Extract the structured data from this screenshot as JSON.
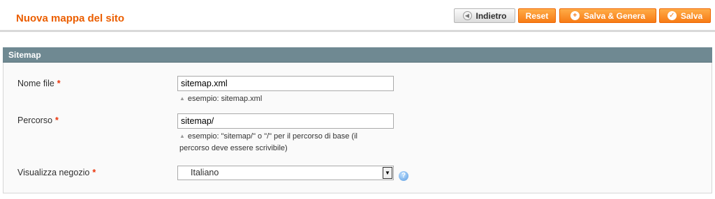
{
  "header": {
    "title": "Nuova mappa del sito",
    "buttons": {
      "back": "Indietro",
      "reset": "Reset",
      "save_generate": "Salva & Genera",
      "save": "Salva"
    }
  },
  "fieldset": {
    "title": "Sitemap",
    "fields": {
      "filename": {
        "label": "Nome file",
        "required_mark": "*",
        "value": "sitemap.xml",
        "note": "esempio: sitemap.xml"
      },
      "path": {
        "label": "Percorso",
        "required_mark": "*",
        "value": "sitemap/",
        "note": "esempio: \"sitemap/\" o \"/\" per il percorso di base (il percorso deve essere scrivibile)"
      },
      "store": {
        "label": "Visualizza negozio",
        "required_mark": "*",
        "selected": "Italiano"
      }
    }
  },
  "icons": {
    "back": "circle-left-arrow-icon",
    "save_generate": "plus-circle-icon",
    "save": "check-circle-icon",
    "note": "up-triangle-icon",
    "help": "help-icon",
    "dropdown": "dropdown-arrow-icon"
  },
  "colors": {
    "title": "#eb5e00",
    "button_orange": "#f77c16",
    "section_header": "#6f8992",
    "required": "#eb340a"
  }
}
